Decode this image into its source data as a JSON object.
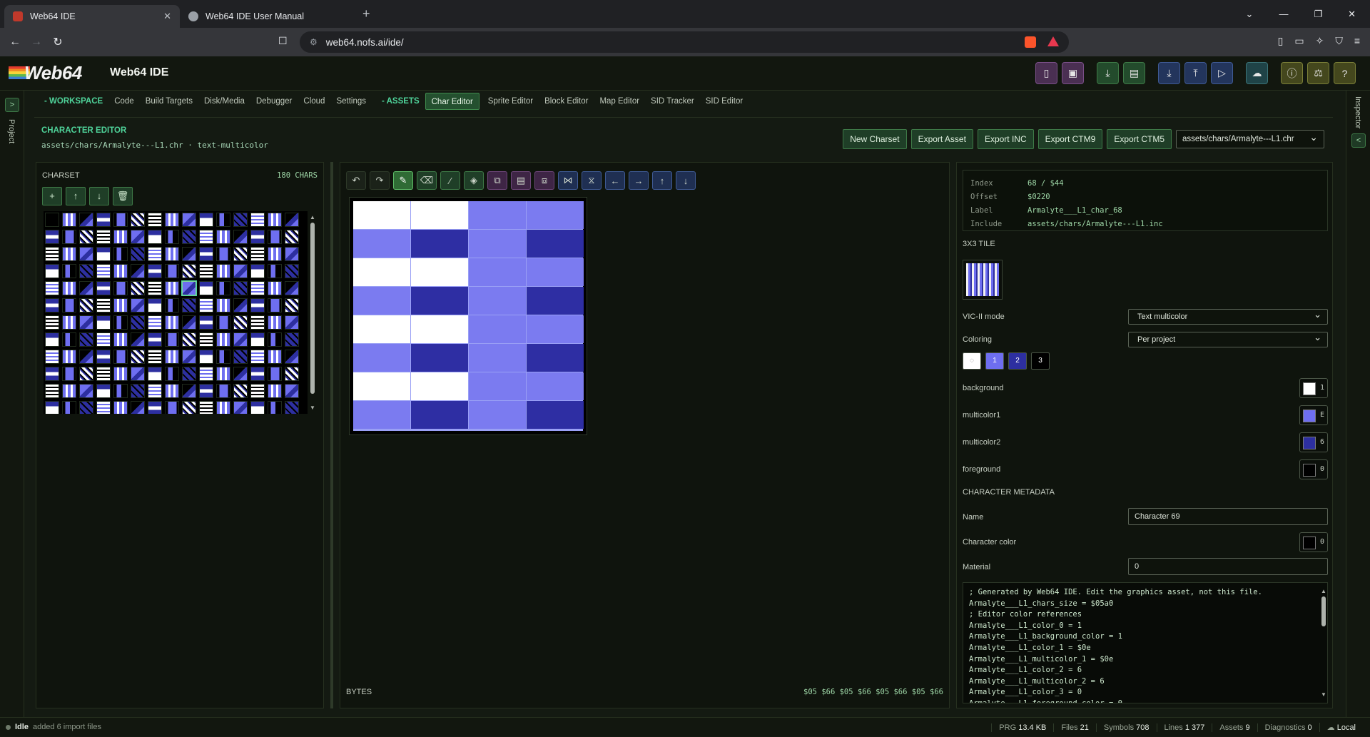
{
  "browser": {
    "tabs": [
      {
        "title": "Web64 IDE",
        "active": true
      },
      {
        "title": "Web64 IDE User Manual",
        "active": false
      }
    ],
    "url": "web64.nofs.ai/ide/"
  },
  "app": {
    "logo_text": "Web64",
    "title": "Web64 IDE"
  },
  "rails": {
    "left_label": "Project",
    "right_label": "Inspector"
  },
  "menu": {
    "workspace_label": "- WORKSPACE",
    "workspace_items": [
      "Code",
      "Build Targets",
      "Disk/Media",
      "Debugger",
      "Cloud",
      "Settings"
    ],
    "assets_label": "- ASSETS",
    "asset_items": [
      "Char Editor",
      "Sprite Editor",
      "Block Editor",
      "Map Editor",
      "SID Tracker",
      "SID Editor"
    ],
    "active": "Char Editor"
  },
  "editor": {
    "title": "CHARACTER EDITOR",
    "subtitle": "assets/chars/Armalyte---L1.chr · text-multicolor",
    "buttons": [
      "New Charset",
      "Export Asset",
      "Export INC",
      "Export CTM9",
      "Export CTM5"
    ],
    "file_select": "assets/chars/Armalyte---L1.chr"
  },
  "charset": {
    "title": "CHARSET",
    "count": "180 CHARS"
  },
  "canvas": {
    "bytes_label": "BYTES",
    "bytes_value": "$05 $66 $05 $66 $05 $66 $05 $66",
    "rows": [
      [
        "#ffffff",
        "#ffffff",
        "#7b7bf0",
        "#7b7bf0"
      ],
      [
        "#7b7bf0",
        "#2e2ea3",
        "#7b7bf0",
        "#2e2ea3"
      ],
      [
        "#ffffff",
        "#ffffff",
        "#7b7bf0",
        "#7b7bf0"
      ],
      [
        "#7b7bf0",
        "#2e2ea3",
        "#7b7bf0",
        "#2e2ea3"
      ],
      [
        "#ffffff",
        "#ffffff",
        "#7b7bf0",
        "#7b7bf0"
      ],
      [
        "#7b7bf0",
        "#2e2ea3",
        "#7b7bf0",
        "#2e2ea3"
      ],
      [
        "#ffffff",
        "#ffffff",
        "#7b7bf0",
        "#7b7bf0"
      ],
      [
        "#7b7bf0",
        "#2e2ea3",
        "#7b7bf0",
        "#2e2ea3"
      ]
    ]
  },
  "inspector": {
    "info": [
      {
        "key": "Index",
        "value": "68 / $44"
      },
      {
        "key": "Offset",
        "value": "$0220"
      },
      {
        "key": "Label",
        "value": "Armalyte___L1_char_68"
      },
      {
        "key": "Include",
        "value": "assets/chars/Armalyte---L1.inc"
      }
    ],
    "tile_label": "3X3 TILE",
    "vic_label": "VIC-II mode",
    "vic_value": "Text multicolor",
    "coloring_label": "Coloring",
    "coloring_value": "Per project",
    "swatches": [
      {
        "label": "",
        "bg": "#ffffff",
        "fg": "#555"
      },
      {
        "label": "1",
        "bg": "#6e6ef0",
        "fg": "#fff"
      },
      {
        "label": "2",
        "bg": "#2d2fa0",
        "fg": "#fff"
      },
      {
        "label": "3",
        "bg": "#000000",
        "fg": "#fff"
      }
    ],
    "colors": [
      {
        "name": "background",
        "value": "1",
        "color": "#ffffff"
      },
      {
        "name": "multicolor1",
        "value": "E",
        "color": "#6e6ef0"
      },
      {
        "name": "multicolor2",
        "value": "6",
        "color": "#2d2fa0"
      },
      {
        "name": "foreground",
        "value": "0",
        "color": "#000000"
      }
    ],
    "meta_title": "CHARACTER METADATA",
    "name_label": "Name",
    "name_value": "Character 69",
    "charcolor_label": "Character color",
    "charcolor_value": "0",
    "material_label": "Material",
    "material_value": "0",
    "code": "; Generated by Web64 IDE. Edit the graphics asset, not this file.\nArmalyte___L1_chars_size = $05a0\n; Editor color references\nArmalyte___L1_color_0 = 1\nArmalyte___L1_background_color = 1\nArmalyte___L1_color_1 = $0e\nArmalyte___L1_multicolor_1 = $0e\nArmalyte___L1_color_2 = 6\nArmalyte___L1_multicolor_2 = 6\nArmalyte___L1_color_3 = 0\nArmalyte___L1_foreground_color = 0"
  },
  "status": {
    "state": "Idle",
    "message": "added 6 import files",
    "items": [
      {
        "label": "PRG",
        "value": "13.4 KB"
      },
      {
        "label": "Files",
        "value": "21"
      },
      {
        "label": "Symbols",
        "value": "708"
      },
      {
        "label": "Lines",
        "value": "1 377"
      },
      {
        "label": "Assets",
        "value": "9"
      },
      {
        "label": "Diagnostics",
        "value": "0"
      },
      {
        "label": "",
        "value": "Local"
      }
    ]
  }
}
